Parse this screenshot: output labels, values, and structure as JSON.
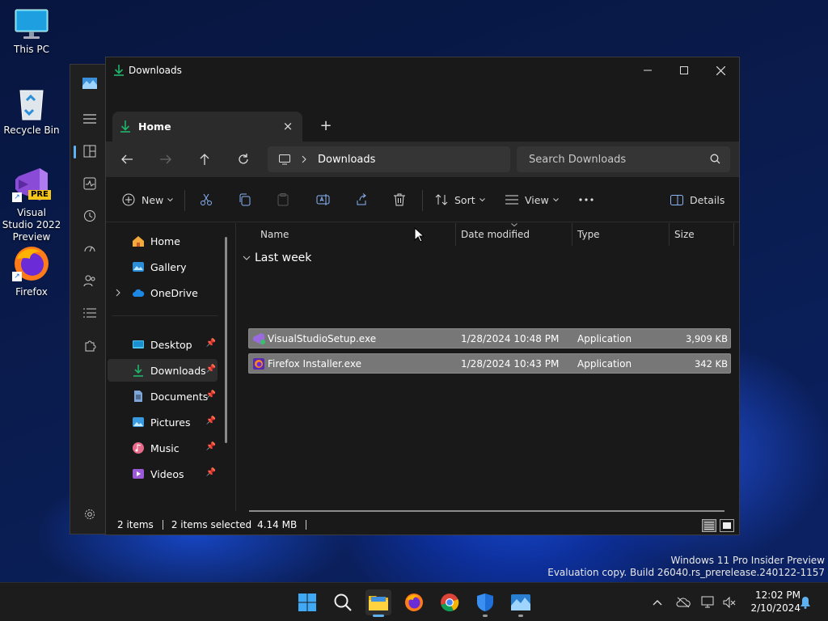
{
  "desktop": {
    "icons": [
      {
        "label": "This PC"
      },
      {
        "label": "Recycle Bin"
      },
      {
        "label": "Visual Studio 2022 Preview",
        "badge": "PRE"
      },
      {
        "label": "Firefox"
      }
    ],
    "watermark": {
      "line1": "Windows 11 Pro Insider Preview",
      "line2": "Evaluation copy. Build 26040.rs_prerelease.240122-1157"
    }
  },
  "explorer": {
    "title": "Downloads",
    "tab": {
      "label": "Home"
    },
    "address": {
      "crumb": "Downloads"
    },
    "search": {
      "placeholder": "Search Downloads"
    },
    "commands": {
      "new": "New",
      "sort": "Sort",
      "view": "View",
      "details": "Details"
    },
    "nav": {
      "top": [
        "Home",
        "Gallery",
        "OneDrive"
      ],
      "pinned": [
        "Desktop",
        "Downloads",
        "Documents",
        "Pictures",
        "Music",
        "Videos"
      ]
    },
    "columns": {
      "name": "Name",
      "date": "Date modified",
      "type": "Type",
      "size": "Size"
    },
    "group": "Last week",
    "files": [
      {
        "name": "VisualStudioSetup.exe",
        "date": "1/28/2024 10:48 PM",
        "type": "Application",
        "size": "3,909 KB"
      },
      {
        "name": "Firefox Installer.exe",
        "date": "1/28/2024 10:43 PM",
        "type": "Application",
        "size": "342 KB"
      }
    ],
    "status": {
      "items": "2 items",
      "selected": "2 items selected",
      "size": "4.14 MB"
    }
  },
  "taskbar": {
    "clock": {
      "time": "12:02 PM",
      "date": "2/10/2024"
    }
  },
  "colors": {
    "accent": "#1fb46a",
    "taskbar_active": "#5fb2f2",
    "window_bg": "#191919"
  }
}
